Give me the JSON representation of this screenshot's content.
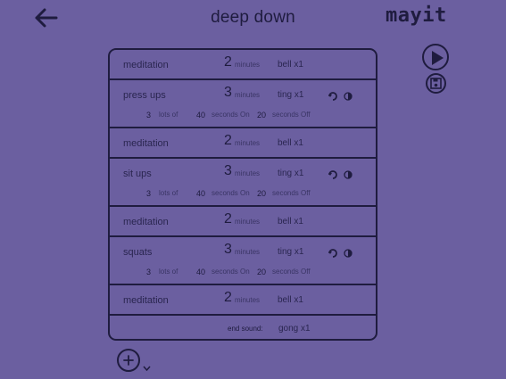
{
  "header": {
    "title": "deep down",
    "logo": "mayit"
  },
  "icons": {
    "back": "arrow-left-icon",
    "play": "play-icon",
    "save": "floppy-disk-icon",
    "add": "plus-icon",
    "chevron": "chevron-down-icon",
    "repeat": "repeat-icon",
    "half": "half-circle-icon"
  },
  "routine": [
    {
      "name": "meditation",
      "minutes": "2",
      "minutes_label": "minutes",
      "sound": "bell x1"
    },
    {
      "name": "press ups",
      "minutes": "3",
      "minutes_label": "minutes",
      "sound": "ting x1",
      "sets": "3",
      "sets_label": "lots of",
      "on": "40",
      "on_label": "seconds On",
      "off": "20",
      "off_label": "seconds Off"
    },
    {
      "name": "meditation",
      "minutes": "2",
      "minutes_label": "minutes",
      "sound": "bell x1"
    },
    {
      "name": "sit ups",
      "minutes": "3",
      "minutes_label": "minutes",
      "sound": "ting x1",
      "sets": "3",
      "sets_label": "lots of",
      "on": "40",
      "on_label": "seconds On",
      "off": "20",
      "off_label": "seconds Off"
    },
    {
      "name": "meditation",
      "minutes": "2",
      "minutes_label": "minutes",
      "sound": "bell x1"
    },
    {
      "name": "squats",
      "minutes": "3",
      "minutes_label": "minutes",
      "sound": "ting x1",
      "sets": "3",
      "sets_label": "lots of",
      "on": "40",
      "on_label": "seconds On",
      "off": "20",
      "off_label": "seconds Off"
    },
    {
      "name": "meditation",
      "minutes": "2",
      "minutes_label": "minutes",
      "sound": "bell x1"
    }
  ],
  "end": {
    "label": "end sound:",
    "sound": "gong x1"
  },
  "colors": {
    "background": "#6b5fa0",
    "ink": "#1f1c3f"
  }
}
